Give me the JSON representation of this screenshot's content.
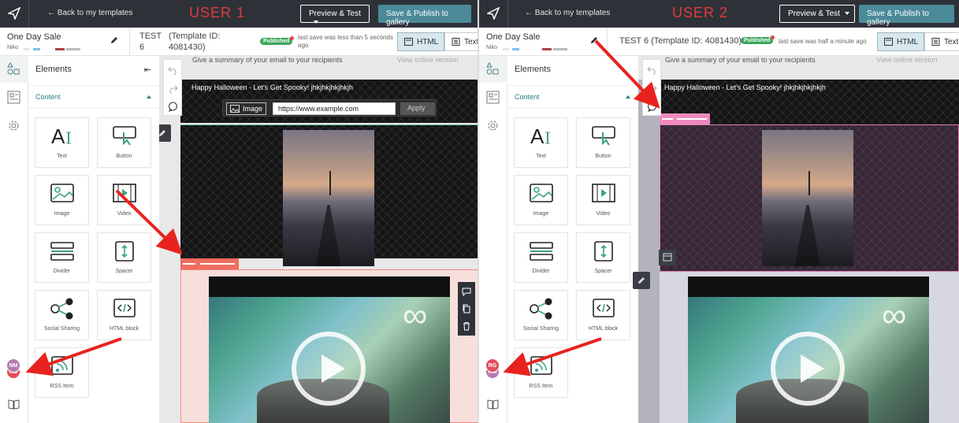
{
  "user1": {
    "user_label": "USER 1",
    "back_link": "← Back to my templates",
    "preview_btn": "Preview & Test",
    "publish_btn": "Save & Publish to gallery",
    "sale_name": "One Day Sale",
    "owner": "Niko",
    "template_line1": "TEST",
    "template_line2": "6",
    "template_id_line1": "(Template ID:",
    "template_id_line2": "4081430)",
    "published_badge": "Published",
    "save_status_line1": "last save was less than 5 seconds",
    "save_status_line2": "ago",
    "html_btn": "HTML",
    "text_btn": "Text",
    "panel_title": "Elements",
    "section_title": "Content",
    "tiles": [
      "Text",
      "Button",
      "Image",
      "Video",
      "Divider",
      "Spacer",
      "Social Sharing",
      "HTML block",
      "RSS Item"
    ],
    "summary": "Give a summary of your email to your recipients",
    "view_online": "View online version",
    "halloween": "Happy Halloween - Let's Get Spooky! jhkjhkjhkjhkjh",
    "image_btn": "Image",
    "url_value": "https://www.example.com",
    "apply_btn": "Apply",
    "avatar_front": "NM",
    "avatar_back": "RG"
  },
  "user2": {
    "user_label": "USER 2",
    "back_link": "← Back to my templates",
    "preview_btn": "Preview & Test",
    "publish_btn": "Save & Publish to gallery",
    "sale_name": "One Day Sale",
    "owner": "Niko",
    "template_title": "TEST 6  (Template ID: 4081430)",
    "published_badge": "Published",
    "save_status": "last save was half a minute ago",
    "html_btn": "HTML",
    "text_btn": "Text",
    "panel_title": "Elements",
    "section_title": "Content",
    "tiles": [
      "Text",
      "Button",
      "Image",
      "Video",
      "Divider",
      "Spacer",
      "Social Sharing",
      "HTML block",
      "RSS Item"
    ],
    "summary": "Give a summary of your email to your recipients",
    "view_online": "View online version",
    "halloween": "Happy Halloween - Let's Get Spooky! jhkjhkjhkjhkjh",
    "avatar_front": "RG",
    "avatar_back": "NM"
  },
  "colors": {
    "topbar": "#2e3238",
    "publish": "#4b8a99",
    "accent_teal": "#2f7a7a",
    "user_label_red": "#e23a3a",
    "published_green": "#3ba55c",
    "annotation_arrow": "#e8231f",
    "avatar_nm": "#b57ab0",
    "avatar_rg": "#e0505a"
  }
}
